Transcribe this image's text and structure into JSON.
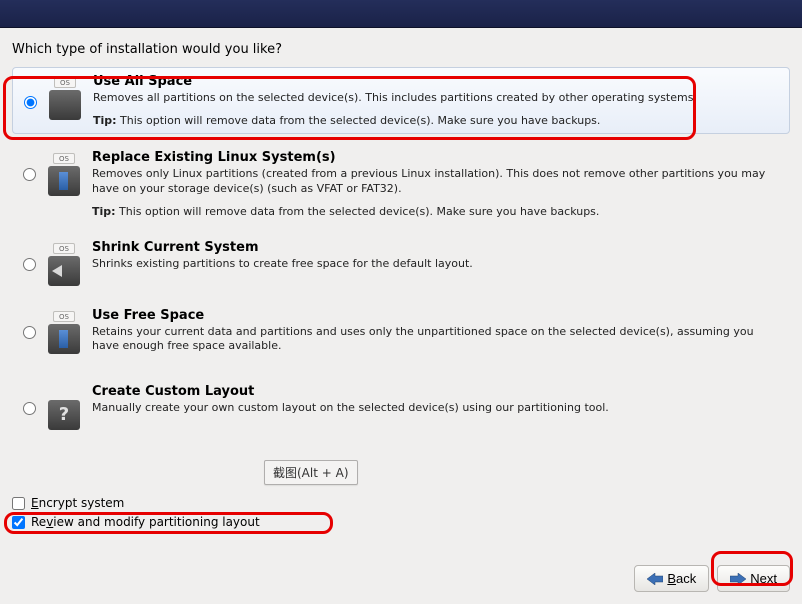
{
  "prompt": "Which type of installation would you like?",
  "options": [
    {
      "title": "Use All Space",
      "desc": "Removes all partitions on the selected device(s).  This includes partitions created by other operating systems.",
      "tip_label": "Tip:",
      "tip_text": " This option will remove data from the selected device(s).  Make sure you have backups.",
      "selected": true,
      "icon_tab": "OS"
    },
    {
      "title": "Replace Existing Linux System(s)",
      "desc": "Removes only Linux partitions (created from a previous Linux installation).  This does not remove other partitions you may have on your storage device(s) (such as VFAT or FAT32).",
      "tip_label": "Tip:",
      "tip_text": " This option will remove data from the selected device(s).  Make sure you have backups.",
      "selected": false,
      "icon_tab": "OS"
    },
    {
      "title": "Shrink Current System",
      "desc": "Shrinks existing partitions to create free space for the default layout.",
      "tip_label": "",
      "tip_text": "",
      "selected": false,
      "icon_tab": "OS"
    },
    {
      "title": "Use Free Space",
      "desc": "Retains your current data and partitions and uses only the unpartitioned space on the selected device(s), assuming you have enough free space available.",
      "tip_label": "",
      "tip_text": "",
      "selected": false,
      "icon_tab": "OS"
    },
    {
      "title": "Create Custom Layout",
      "desc": "Manually create your own custom layout on the selected device(s) using our partitioning tool.",
      "tip_label": "",
      "tip_text": "",
      "selected": false,
      "icon_tab": ""
    }
  ],
  "screenshot_badge": "截图(Alt + A)",
  "checks": {
    "encrypt_key": "E",
    "encrypt_rest": "ncrypt system",
    "encrypt_checked": false,
    "review_key": "v",
    "review_pre": "Re",
    "review_post": "iew and modify partitioning layout",
    "review_checked": true
  },
  "buttons": {
    "back_key": "B",
    "back_rest": "ack",
    "next_key": "N",
    "next_rest": "ext"
  }
}
